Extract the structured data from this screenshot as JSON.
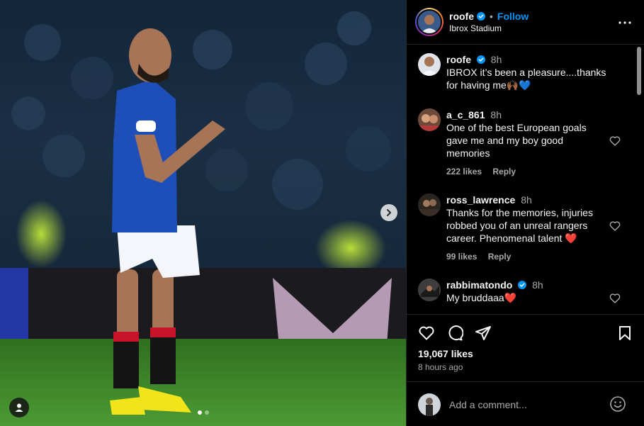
{
  "post": {
    "username": "roofe",
    "follow_label": "Follow",
    "separator": "•",
    "location": "Ibrox Stadium"
  },
  "comments": [
    {
      "user": "roofe",
      "verified": true,
      "time": "8h",
      "text": "IBROX it’s been a pleasure....thanks for having me🙌🏾💙"
    },
    {
      "user": "a_c_861",
      "verified": false,
      "time": "8h",
      "text": "One of the best European goals gave me and my boy good memories",
      "likes": "222 likes",
      "reply": "Reply"
    },
    {
      "user": "ross_lawrence",
      "verified": false,
      "time": "8h",
      "text": "Thanks for the memories, injuries robbed you of an unreal rangers career. Phenomenal talent ❤️",
      "likes": "99 likes",
      "reply": "Reply"
    },
    {
      "user": "rabbimatondo",
      "verified": true,
      "time": "8h",
      "text": "My bruddaaa❤️"
    }
  ],
  "footer": {
    "likes": "19,067 likes",
    "posted": "8 hours ago",
    "comment_placeholder": "Add a comment..."
  },
  "colors": {
    "accent": "#0095f6",
    "kit_blue": "#1e4fb8",
    "pitch_green": "#3f8a2c"
  },
  "icons": {
    "header": [
      "verified-badge-icon",
      "more-options-icon"
    ],
    "media": [
      "chevron-right-icon",
      "user-tag-icon"
    ],
    "actions": [
      "heart-icon",
      "comment-icon",
      "share-icon",
      "bookmark-icon",
      "emoji-icon"
    ]
  }
}
